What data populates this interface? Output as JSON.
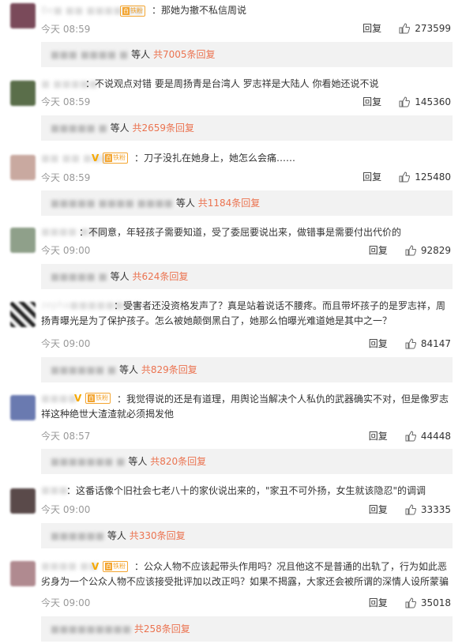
{
  "reply_label": "回复",
  "replies_word": "等人",
  "accent_color": "#eb7350",
  "comments": [
    {
      "name": "Be■ ■■ ■■■■ ■■",
      "badges": {
        "v": false,
        "fan": true
      },
      "text": "：那她为撤不私信周说",
      "time": "今天 08:59",
      "likes": "273599",
      "replies": {
        "names": "■■■ ■■■■ ■",
        "total": "共7005条回复"
      },
      "avatar_color": "#7a4a5a"
    },
    {
      "name": "■ ■■■■■",
      "badges": {
        "v": false,
        "fan": false
      },
      "text": "：不说观点对错 要是周扬青是台湾人 罗志祥是大陆人 你看她还说不说",
      "time": "今天 08:59",
      "likes": "145360",
      "replies": {
        "names": "■■■■■ ■",
        "total": "共2659条回复"
      },
      "avatar_color": "#5a6e4a"
    },
    {
      "name": "■■ ■■ ■■■",
      "badges": {
        "v": true,
        "fan": true
      },
      "text": "：刀子没扎在她身上，她怎么会痛……",
      "time": "今天 08:59",
      "likes": "125480",
      "replies": {
        "names": "■■■■■ ■■■■ ■■■■",
        "total": "共1184条回复"
      },
      "avatar_color": "#c9a9a0"
    },
    {
      "name": "■■■■ ■■■",
      "badges": {
        "v": false,
        "fan": false
      },
      "text": "：不同意，年轻孩子需要知道，受了委屈要说出来，做错事是需要付出代价的",
      "time": "今天 09:00",
      "likes": "92829",
      "replies": {
        "names": "■■■■■ ■",
        "total": "共624条回复"
      },
      "avatar_color": "#8fa08a"
    },
    {
      "name": "zepha■■■■■■■■",
      "badges": {
        "v": false,
        "fan": false
      },
      "text": "：受害者还没资格发声了？真是站着说话不腰疼。而且带坏孩子的是罗志祥，周扬青曝光是为了保护孩子。怎么被她颠倒黑白了，她那么怕曝光难道她是其中之一？",
      "time": "今天 09:00",
      "likes": "84147",
      "replies": {
        "names": "■■■■■■ ■",
        "total": "共829条回复"
      },
      "avatar_color": "#222222"
    },
    {
      "name": "■■■■",
      "badges": {
        "v": true,
        "fan": true
      },
      "text": "：我觉得说的还是有道理，用舆论当解决个人私仇的武器确实不对，但是像罗志祥这种绝世大渣渣就必须揭发他",
      "time": "今天 08:57",
      "likes": "44448",
      "replies": {
        "names": "■■■■■■■ ■",
        "total": "共820条回复"
      },
      "avatar_color": "#6a7ab0"
    },
    {
      "name": "■■■",
      "badges": {
        "v": false,
        "fan": false
      },
      "text": "：这番话像个旧社会七老八十的家伙说出来的，\"家丑不可外扬，女生就该隐忍\"的调调",
      "time": "今天 09:00",
      "likes": "33335",
      "replies": {
        "names": "■■■■■■",
        "total": "等人 共330条回复"
      },
      "avatar_color": "#5a4a4a"
    },
    {
      "name": "■■■■ ■■",
      "badges": {
        "v": true,
        "fan": true
      },
      "text": "：公众人物不应该起带头作用吗？况且他这不是普通的出轨了，行为如此恶劣身为一个公众人物不应该接受批评加以改正吗？如果不揭露，大家还会被所谓的深情人设所蒙骗",
      "time": "今天 09:00",
      "likes": "35018",
      "replies": {
        "names": "■■■■■■■■■",
        "total": "共258条回复"
      },
      "avatar_color": "#b08a90"
    }
  ]
}
